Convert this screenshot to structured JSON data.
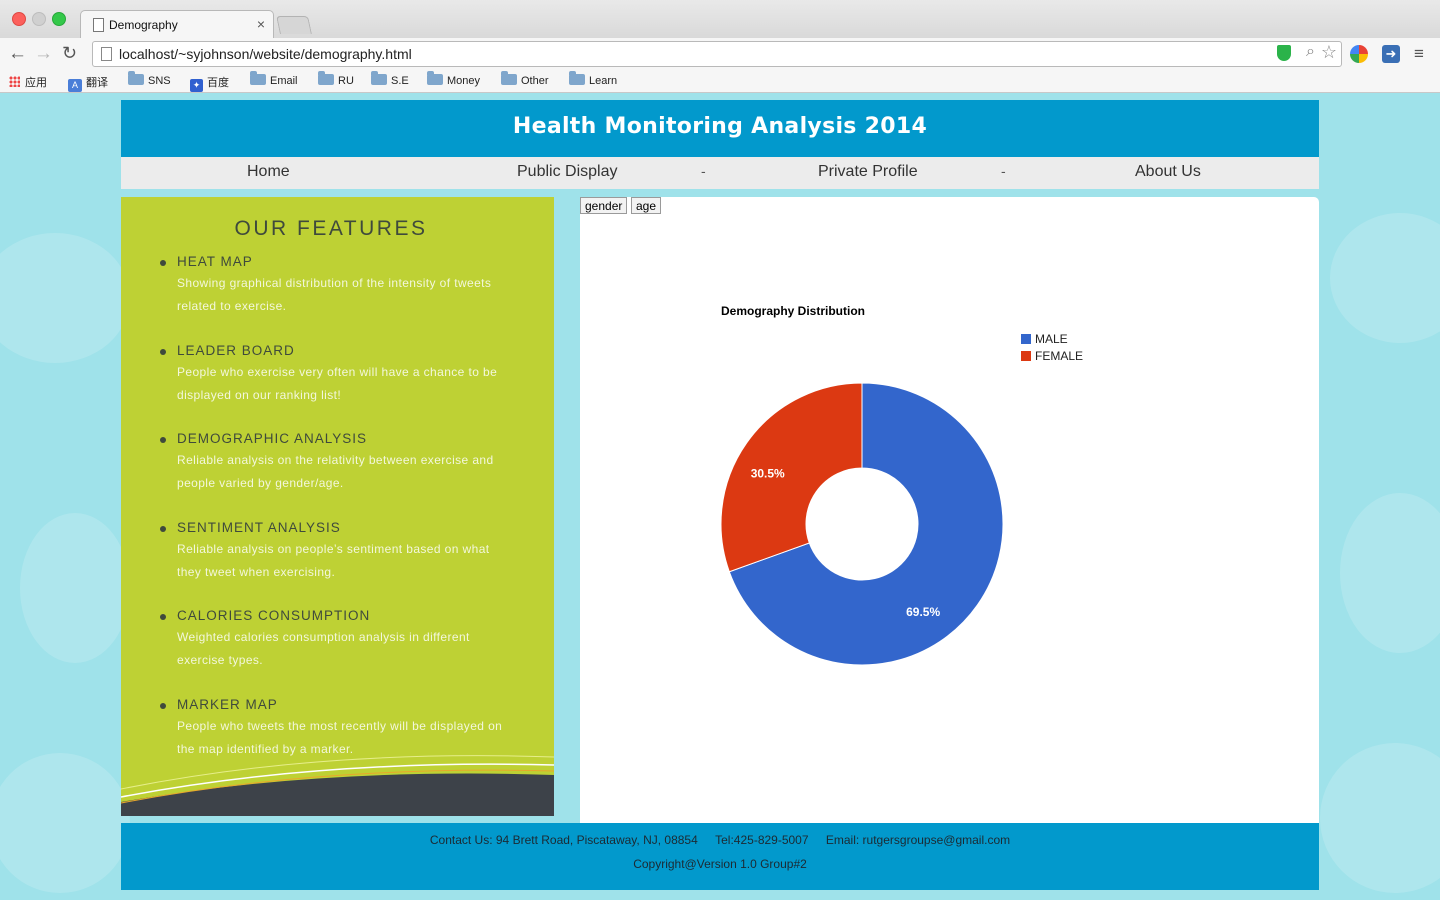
{
  "browser": {
    "tab_title": "Demography",
    "url": "localhost/~syjohnson/website/demography.html",
    "bookmarks": [
      "应用",
      "翻译",
      "SNS",
      "百度",
      "Email",
      "RU",
      "S.E",
      "Money",
      "Other",
      "Learn"
    ]
  },
  "site": {
    "title": "Health Monitoring Analysis 2014",
    "nav": [
      "Home",
      "Public Display",
      "Private Profile",
      "About Us"
    ],
    "nav_separator": "-"
  },
  "features": {
    "heading": "OUR FEATURES",
    "items": [
      {
        "title": "HEAT MAP",
        "desc": "Showing graphical distribution of the intensity of tweets related to exercise."
      },
      {
        "title": "LEADER BOARD",
        "desc": "People who exercise very often will have a chance to be displayed on our ranking list!"
      },
      {
        "title": "DEMOGRAPHIC ANALYSIS",
        "desc": "Reliable analysis on the relativity between exercise and people varied by gender/age."
      },
      {
        "title": "SENTIMENT ANALYSIS",
        "desc": "Reliable analysis on people’s sentiment based on what they tweet when exercising."
      },
      {
        "title": "CALORIES CONSUMPTION",
        "desc": "Weighted calories consumption analysis in different exercise types."
      },
      {
        "title": "MARKER MAP",
        "desc": "People who tweets the most recently will be displayed on the map identified by a marker."
      }
    ]
  },
  "chart_controls": {
    "gender_label": "gender",
    "age_label": "age"
  },
  "chart_data": {
    "type": "pie",
    "donut": true,
    "title": "Demography Distribution",
    "legend_position": "right",
    "categories": [
      "MALE",
      "FEMALE"
    ],
    "values": [
      69.5,
      30.5
    ],
    "labels": [
      "69.5%",
      "30.5%"
    ],
    "colors": [
      "#3366cc",
      "#dc3912"
    ]
  },
  "footer": {
    "contact": "Contact Us: 94 Brett Road, Piscataway, NJ, 08854",
    "tel": "Tel:425-829-5007",
    "email": "Email: rutgersgroupse@gmail.com",
    "copyright": "Copyright@Version 1.0 Group#2"
  }
}
